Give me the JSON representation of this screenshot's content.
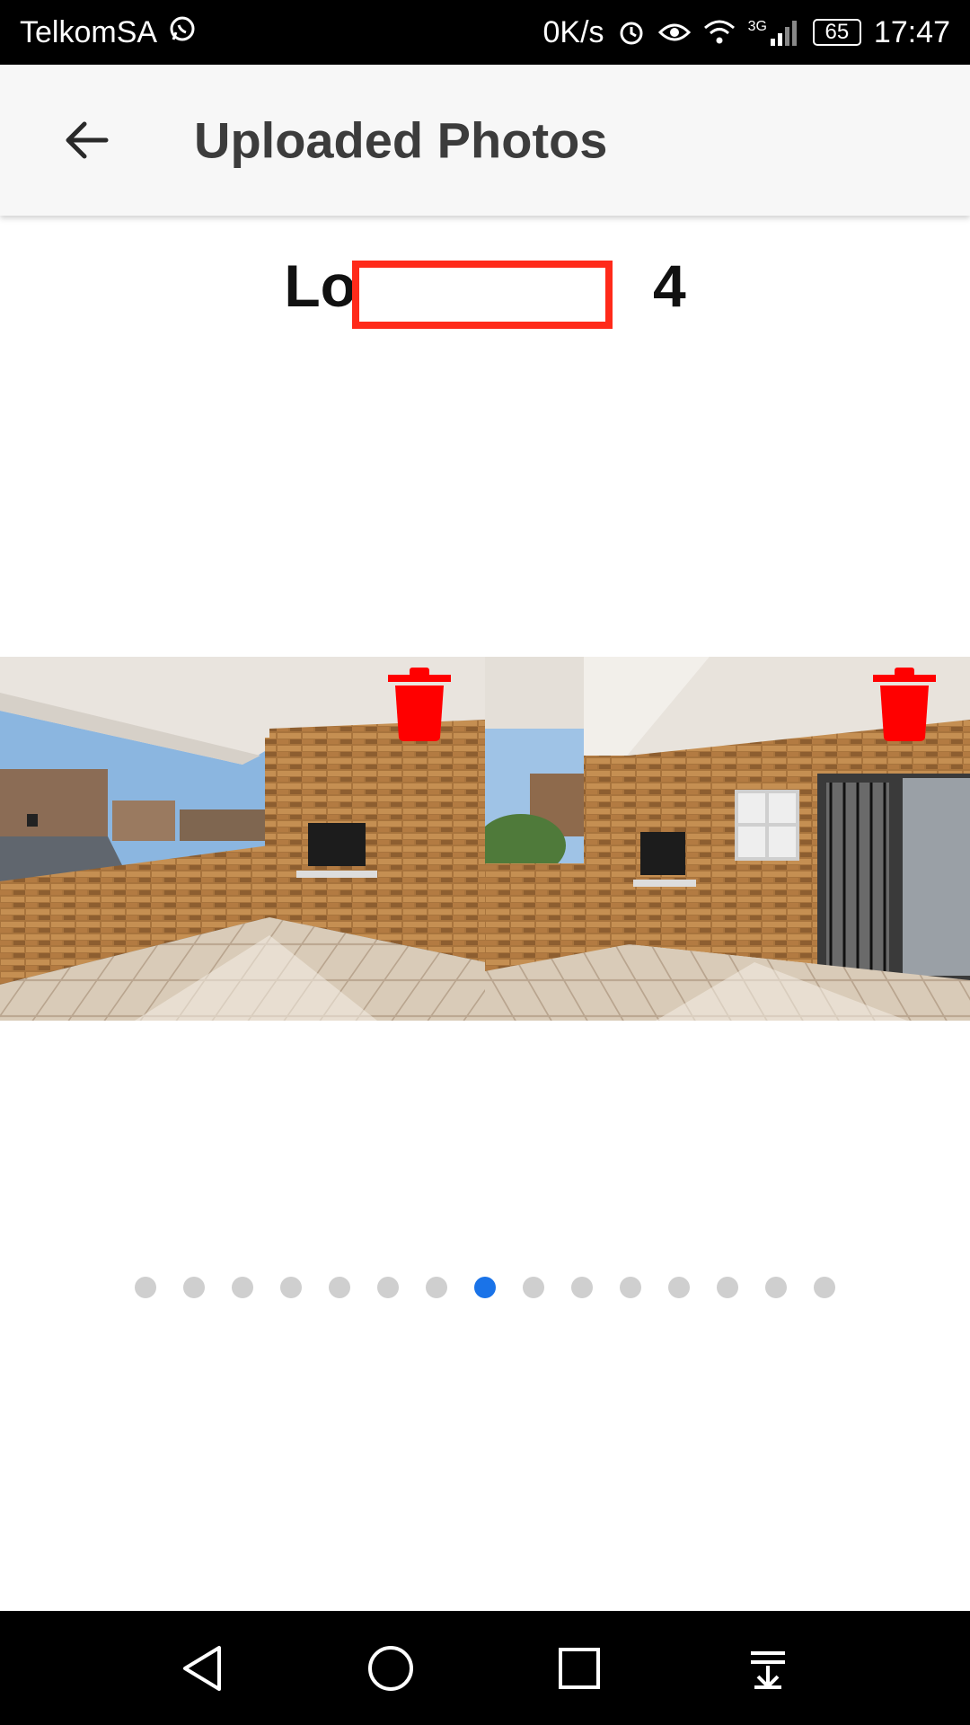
{
  "status_bar": {
    "carrier": "TelkomSA",
    "speed": "0K/s",
    "network": "3G",
    "battery": "65",
    "time": "17:47"
  },
  "app_bar": {
    "title": "Uploaded Photos",
    "back_icon": "arrow-left-icon"
  },
  "heading": {
    "prefix": "Lo",
    "suffix": "4",
    "redacted": true
  },
  "photos": [
    {
      "description": "balcony-left",
      "delete_icon": "trash-icon"
    },
    {
      "description": "balcony-right",
      "delete_icon": "trash-icon"
    }
  ],
  "pagination": {
    "total": 15,
    "current": 8
  },
  "colors": {
    "accent": "#1a73e8",
    "delete": "#ff0000",
    "redaction": "#ff2a1a",
    "app_bar_bg": "#f7f7f7"
  },
  "nav_bar": {
    "icons": [
      "back-triangle-icon",
      "home-circle-icon",
      "recents-square-icon",
      "notifications-pull-icon"
    ]
  }
}
